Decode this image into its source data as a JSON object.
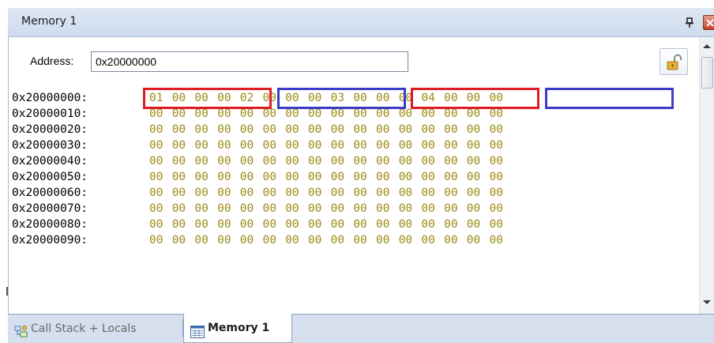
{
  "window": {
    "title": "Memory 1",
    "icons": {
      "pin": "pin-icon",
      "close": "close-icon"
    }
  },
  "toolbar": {
    "address_label": "Address:",
    "address_value": "0x20000000",
    "lock_icon": "unlocked-padlock-icon"
  },
  "memory": {
    "rows": [
      {
        "address": "0x20000000:",
        "bytes": [
          "01",
          "00",
          "00",
          "00",
          "02",
          "00",
          "00",
          "00",
          "03",
          "00",
          "00",
          "00",
          "04",
          "00",
          "00",
          "00"
        ]
      },
      {
        "address": "0x20000010:",
        "bytes": [
          "00",
          "00",
          "00",
          "00",
          "00",
          "00",
          "00",
          "00",
          "00",
          "00",
          "00",
          "00",
          "00",
          "00",
          "00",
          "00"
        ]
      },
      {
        "address": "0x20000020:",
        "bytes": [
          "00",
          "00",
          "00",
          "00",
          "00",
          "00",
          "00",
          "00",
          "00",
          "00",
          "00",
          "00",
          "00",
          "00",
          "00",
          "00"
        ]
      },
      {
        "address": "0x20000030:",
        "bytes": [
          "00",
          "00",
          "00",
          "00",
          "00",
          "00",
          "00",
          "00",
          "00",
          "00",
          "00",
          "00",
          "00",
          "00",
          "00",
          "00"
        ]
      },
      {
        "address": "0x20000040:",
        "bytes": [
          "00",
          "00",
          "00",
          "00",
          "00",
          "00",
          "00",
          "00",
          "00",
          "00",
          "00",
          "00",
          "00",
          "00",
          "00",
          "00"
        ]
      },
      {
        "address": "0x20000050:",
        "bytes": [
          "00",
          "00",
          "00",
          "00",
          "00",
          "00",
          "00",
          "00",
          "00",
          "00",
          "00",
          "00",
          "00",
          "00",
          "00",
          "00"
        ]
      },
      {
        "address": "0x20000060:",
        "bytes": [
          "00",
          "00",
          "00",
          "00",
          "00",
          "00",
          "00",
          "00",
          "00",
          "00",
          "00",
          "00",
          "00",
          "00",
          "00",
          "00"
        ]
      },
      {
        "address": "0x20000070:",
        "bytes": [
          "00",
          "00",
          "00",
          "00",
          "00",
          "00",
          "00",
          "00",
          "00",
          "00",
          "00",
          "00",
          "00",
          "00",
          "00",
          "00"
        ]
      },
      {
        "address": "0x20000080:",
        "bytes": [
          "00",
          "00",
          "00",
          "00",
          "00",
          "00",
          "00",
          "00",
          "00",
          "00",
          "00",
          "00",
          "00",
          "00",
          "00",
          "00"
        ]
      },
      {
        "address": "0x20000090:",
        "bytes": [
          "00",
          "00",
          "00",
          "00",
          "00",
          "00",
          "00",
          "00",
          "00",
          "00",
          "00",
          "00",
          "00",
          "00",
          "00",
          "00"
        ]
      }
    ],
    "highlights": [
      {
        "color": "#e01b24"
      },
      {
        "color": "#3b3bc6"
      },
      {
        "color": "#e01b24"
      },
      {
        "color": "#3b3bc6"
      }
    ],
    "byte_color": "#9b8a14",
    "address_color": "#000000"
  },
  "tabs": [
    {
      "label": "Call Stack + Locals",
      "icon": "call-stack-icon",
      "active": false
    },
    {
      "label": "Memory 1",
      "icon": "memory-window-icon",
      "active": true
    }
  ]
}
